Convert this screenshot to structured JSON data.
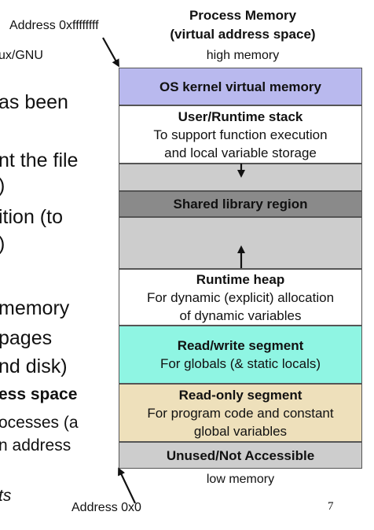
{
  "header": {
    "title_line1": "Process Memory",
    "title_line2": "(virtual address space)",
    "high_label": "high memory",
    "low_label": "low memory",
    "top_address": "Address 0xffffffff",
    "bottom_address": "Address 0x0"
  },
  "segments": [
    {
      "title": "OS kernel virtual memory",
      "desc": [],
      "color": "#b9b9ee"
    },
    {
      "title": "User/Runtime stack",
      "desc": [
        "To support function execution",
        "and local variable storage"
      ],
      "color": "#ffffff"
    },
    {
      "title": "",
      "desc": [],
      "color": "#cdcdcd"
    },
    {
      "title": "Shared library region",
      "desc": [],
      "color": "#8a8a8a"
    },
    {
      "title": "",
      "desc": [],
      "color": "#cdcdcd"
    },
    {
      "title": "Runtime heap",
      "desc": [
        "For dynamic (explicit) allocation",
        "of dynamic variables"
      ],
      "color": "#ffffff"
    },
    {
      "title": "Read/write segment",
      "desc": [
        "For globals (& static locals)"
      ],
      "color": "#8ff5e3"
    },
    {
      "title": "Read-only segment",
      "desc": [
        "For program code and constant",
        "global variables"
      ],
      "color": "#eee0bb"
    },
    {
      "title": "Unused/Not Accessible",
      "desc": [],
      "color": "#cdcdcd"
    }
  ],
  "background_text": {
    "l1": "ux/GNU",
    "l2": "as been",
    "l3": "nt the file",
    "l4": ")",
    "l5": "ition (to",
    "l6": ")",
    "l7": " memory",
    "l8": "pages",
    "l9": "nd disk)",
    "l10": "ess space",
    "l11": "ocesses (a",
    "l12": "n address",
    "l13": "ts"
  },
  "page_number": "7"
}
